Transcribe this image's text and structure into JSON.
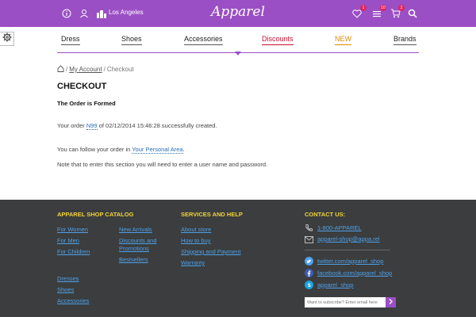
{
  "header": {
    "city": "Los Angeles",
    "logo": "Apparel",
    "icons": [
      "info-icon",
      "user-icon",
      "city-icon",
      "heart-icon",
      "list-icon",
      "cart-icon",
      "search-icon"
    ],
    "badges": {
      "favorites": "1",
      "compare": "10",
      "cart": "2"
    }
  },
  "nav": {
    "items": [
      {
        "label": "Dress",
        "color": "#222222"
      },
      {
        "label": "Shoes",
        "color": "#222222"
      },
      {
        "label": "Accessories",
        "color": "#222222"
      },
      {
        "label": "Discounts",
        "color": "#c8102e"
      },
      {
        "label": "NEW",
        "color": "#e08a00"
      },
      {
        "label": "Brands",
        "color": "#222222"
      }
    ]
  },
  "breadcrumb": {
    "separator1": "/",
    "my_account": "My Account",
    "separator2": "/",
    "current": "Checkout"
  },
  "main": {
    "title": "CHECKOUT",
    "subtitle": "The Order is Formed",
    "order_prefix": "Your order ",
    "order_number": "N99",
    "order_suffix": " of 02/12/2014 15:46:28 successfully created.",
    "follow_prefix": "You can follow your order in ",
    "follow_link": "Your Personal Area",
    "follow_suffix": ".",
    "note": "Note that to enter this section you will need to enter a user name and password."
  },
  "footer": {
    "catalog_heading": "APPAREL SHOP CATALOG",
    "catalog_col1": [
      "For Women",
      "For Men",
      "For Children"
    ],
    "catalog_col2": [
      "New Arrivals",
      "Discounts and",
      "Promotions",
      "Bestsellers"
    ],
    "catalog_col3": [
      "Dresses",
      "Shoes",
      "Accessories"
    ],
    "services_heading": "SERVICES AND HELP",
    "services": [
      "About store",
      "How to buy",
      "Shipping and Payment",
      "Warranty"
    ],
    "contact_heading": "CONTACT US:",
    "phone": "1-800-APPAREL",
    "email": "apparel-shop@appa.rel",
    "twitter": "twitter.com/apparel_shop",
    "facebook": "facebook.com/apparel_shop",
    "skype": "apparel_shop",
    "subscribe_placeholder": "Want to subscribe? Enter email here"
  },
  "colors": {
    "accent": "#9b4fc4",
    "footer_bg": "#3b3d3e",
    "footer_heading": "#f2d23b",
    "link": "#4ea0e8"
  }
}
